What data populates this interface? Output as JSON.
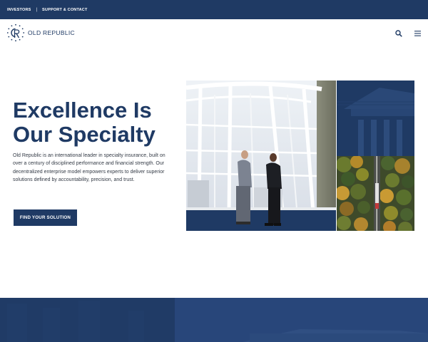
{
  "topbar": {
    "links": [
      "INVESTORS",
      "SUPPORT & CONTACT"
    ],
    "separator": "|"
  },
  "header": {
    "logo_text": "OLD REPUBLIC",
    "search_icon": "search-icon",
    "menu_icon": "hamburger-menu-icon"
  },
  "hero": {
    "title_line1": "Excellence Is",
    "title_line2": "Our Specialty",
    "description": "Old Republic is an international leader in specialty insurance, built on over a century of disciplined performance and financial strength. Our decentralized enterprise model empowers experts to deliver superior solutions defined by accountability, precision, and trust.",
    "cta_label": "FIND YOUR SOLUTION"
  },
  "colors": {
    "navy": "#1f3a64",
    "text": "#333a45",
    "white": "#ffffff"
  }
}
